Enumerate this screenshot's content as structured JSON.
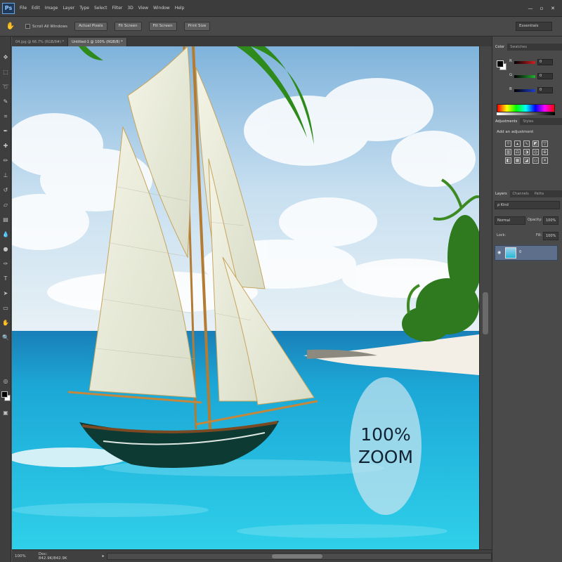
{
  "app": {
    "logo": "Ps",
    "menu": [
      "File",
      "Edit",
      "Image",
      "Layer",
      "Type",
      "Select",
      "Filter",
      "3D",
      "View",
      "Window",
      "Help"
    ],
    "window_controls": [
      "—",
      "▫",
      "✕"
    ]
  },
  "options_bar": {
    "scroll_all_windows": "Scroll All Windows",
    "buttons": [
      "Actual Pixels",
      "Fit Screen",
      "Fill Screen",
      "Print Size"
    ],
    "workspace": "Essentials"
  },
  "doc_tabs": [
    {
      "label": "04.jpg @ 66.7% (RGB/8#) *",
      "active": false
    },
    {
      "label": "Untitled-1 @ 100% (RGB/8) *",
      "active": true
    }
  ],
  "canvas": {
    "zoom_badge_line1": "100%",
    "zoom_badge_line2": "ZOOM"
  },
  "status": {
    "zoom": "100%",
    "doc_info": "Doc: 842.9K/842.9K",
    "arrow": "▸"
  },
  "panels": {
    "color_tabs": [
      "Color",
      "Swatches"
    ],
    "sliders": [
      {
        "label": "R",
        "value": "0",
        "color": "#d02020"
      },
      {
        "label": "G",
        "value": "0",
        "color": "#20b030"
      },
      {
        "label": "B",
        "value": "0",
        "color": "#2040d0"
      }
    ],
    "adjust_tabs": [
      "Adjustments",
      "Styles"
    ],
    "adjust_title": "Add an adjustment",
    "layer_tabs": [
      "Layers",
      "Channels",
      "Paths"
    ],
    "kind_filter": "ρ Kind",
    "blend_mode": "Normal",
    "opacity_label": "Opacity:",
    "opacity_value": "100%",
    "lock_label": "Lock:",
    "fill_label": "Fill:",
    "fill_value": "100%",
    "layer_name": "0"
  }
}
